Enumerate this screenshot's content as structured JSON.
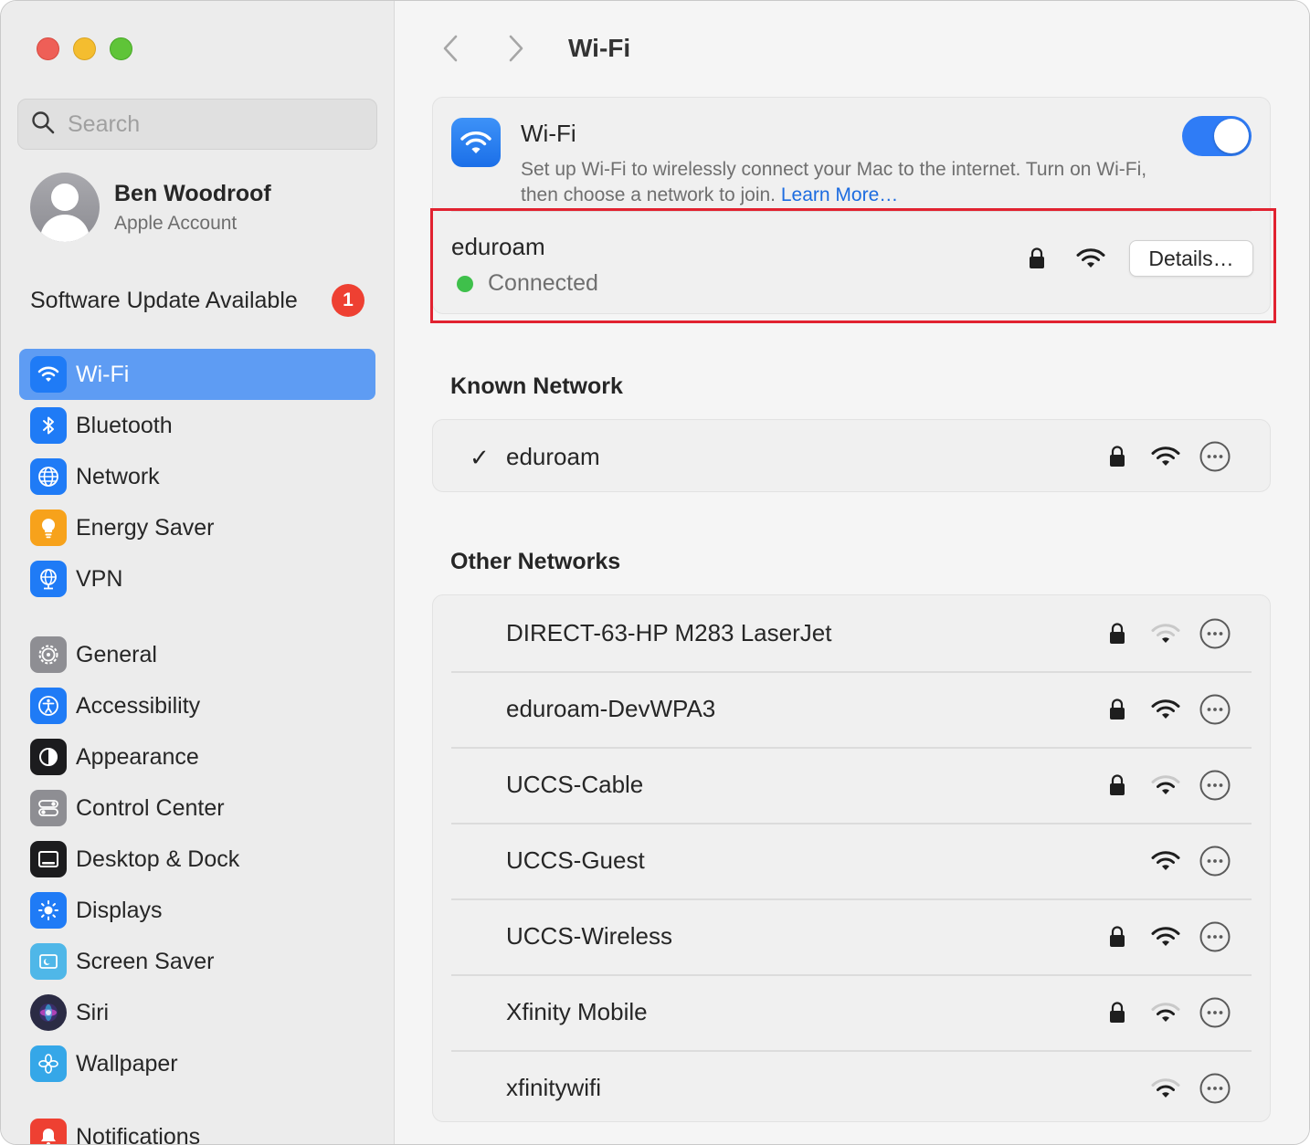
{
  "window": {
    "title": "Wi-Fi"
  },
  "sidebar": {
    "search": {
      "placeholder": "Search"
    },
    "account": {
      "name": "Ben Woodroof",
      "subtitle": "Apple Account"
    },
    "software_update": {
      "label": "Software Update Available",
      "count": "1"
    },
    "items": [
      {
        "id": "wifi",
        "label": "Wi-Fi",
        "icon": "wifi-icon",
        "color": "#1f7bf6",
        "active": true
      },
      {
        "id": "bluetooth",
        "label": "Bluetooth",
        "icon": "bluetooth-icon",
        "color": "#1f7bf6"
      },
      {
        "id": "network",
        "label": "Network",
        "icon": "globe-icon",
        "color": "#1f7bf6"
      },
      {
        "id": "energy",
        "label": "Energy Saver",
        "icon": "lightbulb-icon",
        "color": "#f7a21b"
      },
      {
        "id": "vpn",
        "label": "VPN",
        "icon": "vpn-globe-icon",
        "color": "#1f7bf6"
      },
      {
        "id": "general",
        "label": "General",
        "icon": "gear-icon",
        "color": "#8e8e93"
      },
      {
        "id": "accessibility",
        "label": "Accessibility",
        "icon": "accessibility-icon",
        "color": "#1f7bf6"
      },
      {
        "id": "appearance",
        "label": "Appearance",
        "icon": "appearance-icon",
        "color": "#1c1c1e"
      },
      {
        "id": "control",
        "label": "Control Center",
        "icon": "switches-icon",
        "color": "#8e8e93"
      },
      {
        "id": "desktop",
        "label": "Desktop & Dock",
        "icon": "dock-icon",
        "color": "#1c1c1e"
      },
      {
        "id": "displays",
        "label": "Displays",
        "icon": "sun-icon",
        "color": "#1f7bf6"
      },
      {
        "id": "screensaver",
        "label": "Screen Saver",
        "icon": "screen-saver-icon",
        "color": "#4fb7e8"
      },
      {
        "id": "siri",
        "label": "Siri",
        "icon": "siri-icon",
        "color": "#2b2b44"
      },
      {
        "id": "wallpaper",
        "label": "Wallpaper",
        "icon": "flower-icon",
        "color": "#35a7e8"
      },
      {
        "id": "notifications",
        "label": "Notifications",
        "icon": "bell-icon",
        "color": "#ee4032"
      }
    ]
  },
  "main": {
    "title": "Wi-Fi",
    "wifi_card": {
      "title": "Wi-Fi",
      "description": "Set up Wi-Fi to wirelessly connect your Mac to the internet. Turn on Wi-Fi, then choose a network to join.",
      "learn_more": "Learn More…",
      "enabled": true
    },
    "connected": {
      "name": "eduroam",
      "status": "Connected",
      "details_label": "Details…"
    },
    "known_title": "Known Network",
    "known": [
      {
        "name": "eduroam",
        "check": "✓",
        "locked": true,
        "strength": "strong"
      }
    ],
    "other_title": "Other Networks",
    "other": [
      {
        "name": "DIRECT-63-HP M283 LaserJet",
        "locked": true,
        "strength": "weak"
      },
      {
        "name": "eduroam-DevWPA3",
        "locked": true,
        "strength": "strong"
      },
      {
        "name": "UCCS-Cable",
        "locked": true,
        "strength": "medium"
      },
      {
        "name": "UCCS-Guest",
        "locked": false,
        "strength": "strong"
      },
      {
        "name": "UCCS-Wireless",
        "locked": true,
        "strength": "strong"
      },
      {
        "name": "Xfinity Mobile",
        "locked": true,
        "strength": "medium"
      },
      {
        "name": "xfinitywifi",
        "locked": false,
        "strength": "medium"
      }
    ]
  },
  "colors": {
    "accent": "#2f7cf6",
    "highlight": "#e12230",
    "connected": "#3fc04b",
    "link": "#1d6ce0"
  }
}
